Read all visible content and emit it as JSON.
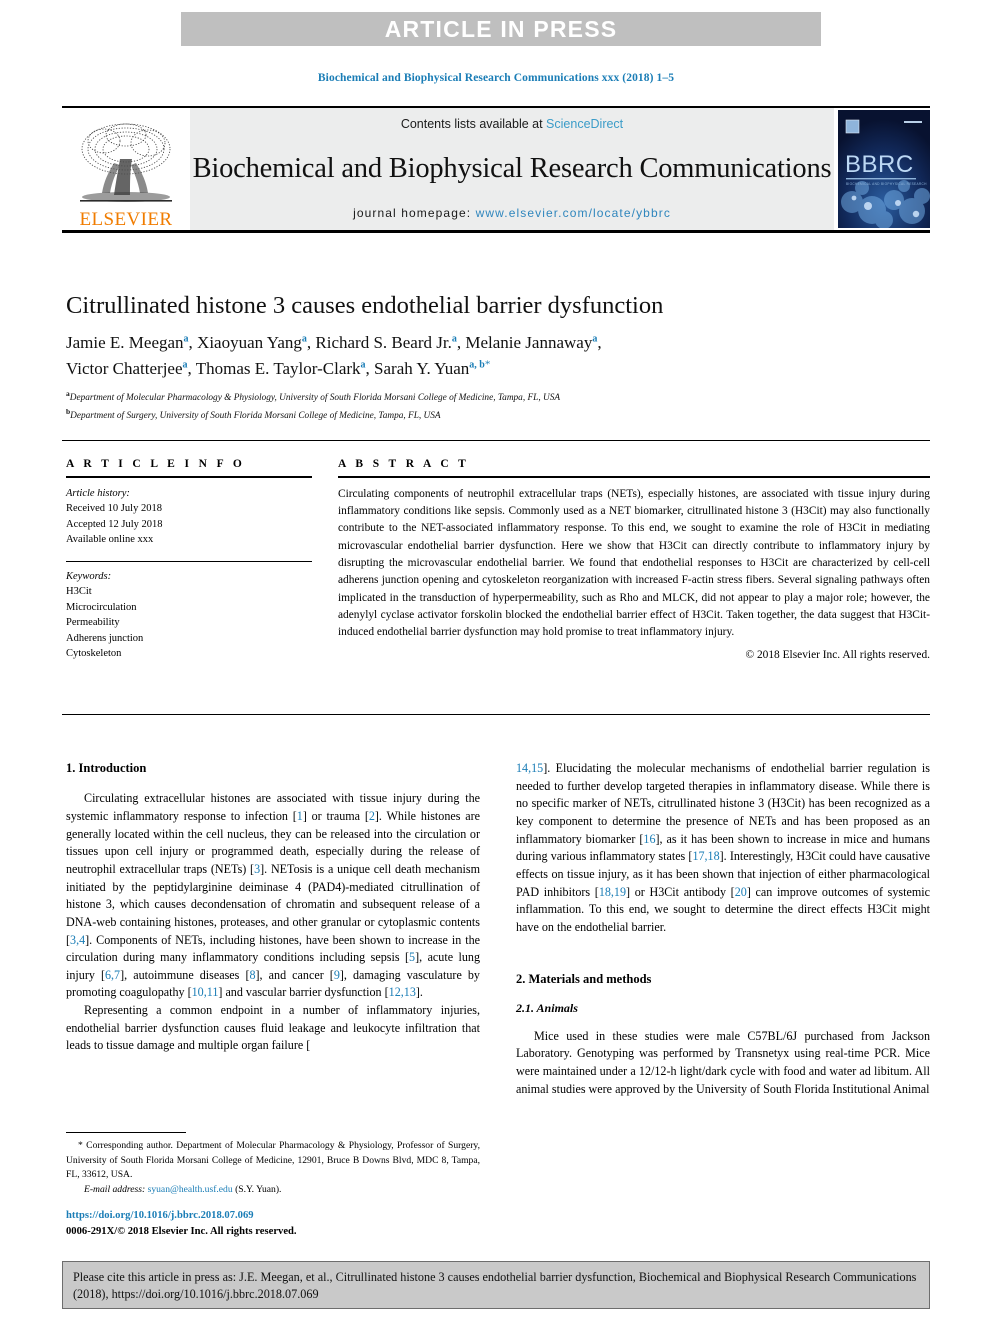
{
  "banner": {
    "label": "ARTICLE IN PRESS"
  },
  "running_head": "Biochemical and Biophysical Research Communications xxx (2018) 1–5",
  "masthead": {
    "publisher_word": "ELSEVIER",
    "contents_prefix": "Contents lists available at ",
    "contents_link": "ScienceDirect",
    "journal_title": "Biochemical and Biophysical Research Communications",
    "homepage_prefix": "journal homepage: ",
    "homepage_url": "www.elsevier.com/locate/ybbrc",
    "cover_title": "BBRC",
    "cover_subtitle": "BIOCHEMICAL AND BIOPHYSICAL RESEARCH COMMUNICATIONS"
  },
  "article": {
    "title": "Citrullinated histone 3 causes endothelial barrier dysfunction",
    "authors_line_1": [
      {
        "name": "Jamie E. Meegan",
        "marks": "a",
        "sep": ", "
      },
      {
        "name": "Xiaoyuan Yang",
        "marks": "a",
        "sep": ", "
      },
      {
        "name": "Richard S. Beard Jr.",
        "marks": "a",
        "sep": ", "
      },
      {
        "name": "Melanie Jannaway",
        "marks": "a",
        "sep": ","
      }
    ],
    "authors_line_2": [
      {
        "name": "Victor Chatterjee",
        "marks": "a",
        "sep": ", "
      },
      {
        "name": "Thomas E. Taylor-Clark",
        "marks": "a",
        "sep": ", "
      },
      {
        "name": "Sarah Y. Yuan",
        "marks": "a, b",
        "star": "*",
        "sep": ""
      }
    ],
    "affiliations": [
      {
        "sup": "a",
        "text": "Department of Molecular Pharmacology & Physiology, University of South Florida Morsani College of Medicine, Tampa, FL, USA"
      },
      {
        "sup": "b",
        "text": "Department of Surgery, University of South Florida Morsani College of Medicine, Tampa, FL, USA"
      }
    ]
  },
  "article_info": {
    "heading": "A R T I C L E  I N F O",
    "history_label": "Article history:",
    "history": [
      "Received 10 July 2018",
      "Accepted 12 July 2018",
      "Available online xxx"
    ],
    "keywords_label": "Keywords:",
    "keywords": [
      "H3Cit",
      "Microcirculation",
      "Permeability",
      "Adherens junction",
      "Cytoskeleton"
    ]
  },
  "abstract": {
    "heading": "A B S T R A C T",
    "body": "Circulating components of neutrophil extracellular traps (NETs), especially histones, are associated with tissue injury during inflammatory conditions like sepsis. Commonly used as a NET biomarker, citrullinated histone 3 (H3Cit) may also functionally contribute to the NET-associated inflammatory response. To this end, we sought to examine the role of H3Cit in mediating microvascular endothelial barrier dysfunction. Here we show that H3Cit can directly contribute to inflammatory injury by disrupting the microvascular endothelial barrier. We found that endothelial responses to H3Cit are characterized by cell-cell adherens junction opening and cytoskeleton reorganization with increased F-actin stress fibers. Several signaling pathways often implicated in the transduction of hyperpermeability, such as Rho and MLCK, did not appear to play a major role; however, the adenylyl cyclase activator forskolin blocked the endothelial barrier effect of H3Cit. Taken together, the data suggest that H3Cit-induced endothelial barrier dysfunction may hold promise to treat inflammatory injury.",
    "copyright": "© 2018 Elsevier Inc. All rights reserved."
  },
  "sections": {
    "introduction_heading": "1. Introduction",
    "intro_p1_a": "Circulating extracellular histones are associated with tissue injury during the systemic inflammatory response to infection [",
    "intro_p1_r1": "1",
    "intro_p1_b": "] or trauma [",
    "intro_p1_r2": "2",
    "intro_p1_c": "]. While histones are generally located within the cell nucleus, they can be released into the circulation or tissues upon cell injury or programmed death, especially during the release of neutrophil extracellular traps (NETs) [",
    "intro_p1_r3": "3",
    "intro_p1_d": "]. NETosis is a unique cell death mechanism initiated by the peptidylarginine deiminase 4 (PAD4)-mediated citrullination of histone 3, which causes decondensation of chromatin and subsequent release of a DNA-web containing histones, proteases, and other granular or cytoplasmic contents [",
    "intro_p1_r4": "3,4",
    "intro_p1_e": "]. Components of NETs, including histones, have been shown to increase in the circulation during many inflammatory conditions including sepsis [",
    "intro_p1_r5": "5",
    "intro_p1_f": "], acute lung injury [",
    "intro_p1_r6": "6,7",
    "intro_p1_g": "], autoimmune diseases [",
    "intro_p1_r7": "8",
    "intro_p1_h": "], and cancer [",
    "intro_p1_r8": "9",
    "intro_p1_i": "], damaging vasculature by promoting coagulopathy [",
    "intro_p1_r9": "10,11",
    "intro_p1_j": "] and vascular barrier dysfunction [",
    "intro_p1_r10": "12,13",
    "intro_p1_k": "].",
    "intro_p2_a": "Representing a common endpoint in a number of inflammatory injuries, endothelial barrier dysfunction causes fluid leakage and leukocyte infiltration that leads to tissue damage and multiple organ failure [",
    "intro_p2_r1": "14,15",
    "intro_p2_b": "]. Elucidating the molecular mechanisms of endothelial barrier regulation is needed to further develop targeted therapies in inflammatory disease. While there is no specific marker of NETs, citrullinated histone 3 (H3Cit) has been recognized as a key component to determine the presence of NETs and has been proposed as an inflammatory biomarker [",
    "intro_p2_r2": "16",
    "intro_p2_c": "], as it has been shown to increase in mice and humans during various inflammatory states [",
    "intro_p2_r3": "17,18",
    "intro_p2_d": "]. Interestingly, H3Cit could have causative effects on tissue injury, as it has been shown that injection of either pharmacological PAD inhibitors [",
    "intro_p2_r4": "18,19",
    "intro_p2_e": "] or H3Cit antibody [",
    "intro_p2_r5": "20",
    "intro_p2_f": "] can improve outcomes of systemic inflammation. To this end, we sought to determine the direct effects H3Cit might have on the endothelial barrier.",
    "methods_heading": "2. Materials and methods",
    "animals_heading": "2.1. Animals",
    "animals_p1": "Mice used in these studies were male C57BL/6J purchased from Jackson Laboratory. Genotyping was performed by Transnetyx using real-time PCR. Mice were maintained under a 12/12-h light/dark cycle with food and water ad libitum. All animal studies were approved by the University of South Florida Institutional Animal"
  },
  "footnote": {
    "corresponding": "* Corresponding author. Department of Molecular Pharmacology & Physiology, Professor of Surgery, University of South Florida Morsani College of Medicine, 12901, Bruce B Downs Blvd, MDC 8, Tampa, FL, 33612, USA.",
    "email_label": "E-mail address:",
    "email": "syuan@health.usf.edu",
    "email_owner": "(S.Y. Yuan).",
    "doi": "https://doi.org/10.1016/j.bbrc.2018.07.069",
    "issn": "0006-291X/© 2018 Elsevier Inc. All rights reserved."
  },
  "citation_box": {
    "text": "Please cite this article in press as: J.E. Meegan, et al., Citrullinated histone 3 causes endothelial barrier dysfunction, Biochemical and Biophysical Research Communications (2018), https://doi.org/10.1016/j.bbrc.2018.07.069"
  },
  "colors": {
    "banner_bg": "#bfbfbf",
    "link_blue": "#1a7db6",
    "sciencedirect_blue": "#3b9cc8",
    "elsevier_orange": "#f07c00",
    "masthead_gray": "#eceded",
    "cite_box_bg": "#c9c9c9"
  }
}
